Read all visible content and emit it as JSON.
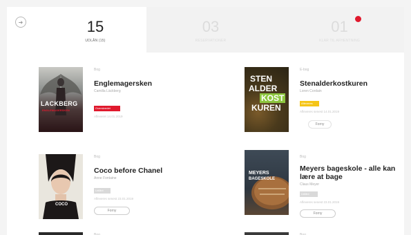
{
  "tabs": [
    {
      "number": "15",
      "label": "UDLÅN (15)"
    },
    {
      "number": "03",
      "label": "RESERVATIONER"
    },
    {
      "number": "01",
      "label": "KLAR TIL AFHENTNING"
    }
  ],
  "books": [
    {
      "type": "Bog",
      "title": "Englemagersken",
      "author": "Camilla Läckberg",
      "badge": "Overskredet",
      "date": "Afleveret 14.01.2019",
      "cover_text": [
        "LACKBERG",
        "ENGLEMAGERSKEN"
      ],
      "colors": {
        "badge": "#e0192d"
      }
    },
    {
      "type": "E-bog",
      "title": "Stenalderkostkuren",
      "author": "Loren Cordain",
      "badge": "Afleveres",
      "date": "Afleveres senest 14.01.2019",
      "button": "Forny",
      "cover_text": [
        "STEN",
        "ALDER",
        "KOST",
        "KUREN"
      ],
      "colors": {
        "badge": "#f5c518"
      }
    },
    {
      "type": "Bog",
      "title": "Coco before Chanel",
      "author": "Anne Fontaine",
      "badge": "Udlånt",
      "date": "Afleveres senest 23.01.2019",
      "button": "Forny",
      "cover_text": [
        "COCO"
      ],
      "colors": {
        "badge": "#d9d9d9"
      }
    },
    {
      "type": "Bog",
      "title": "Meyers bageskole - alle kan lære at bage",
      "author": "Claus Meyer",
      "badge": "Udlånt",
      "date": "Afleveres senest 23.01.2019",
      "button": "Forny",
      "cover_text": [
        "MEYERS",
        "BAGESKOLE"
      ],
      "colors": {
        "badge": "#d9d9d9"
      }
    },
    {
      "type": "Bog"
    },
    {
      "type": "Bog"
    }
  ]
}
